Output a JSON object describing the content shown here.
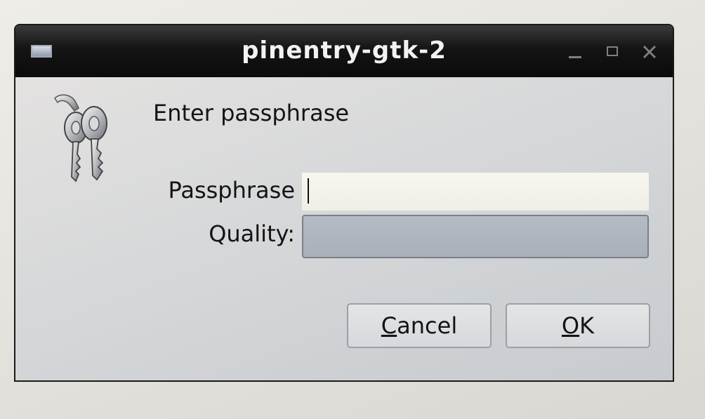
{
  "window": {
    "title": "pinentry-gtk-2"
  },
  "dialog": {
    "prompt": "Enter passphrase",
    "passphrase_label": "Passphrase",
    "passphrase_value": "",
    "quality_label": "Quality:",
    "quality_level": 0
  },
  "buttons": {
    "cancel_mnemonic": "C",
    "cancel_rest": "ancel",
    "ok_mnemonic": "O",
    "ok_rest": "K"
  },
  "icons": {
    "window_menu": "window-menu-icon",
    "keys": "keys-icon",
    "minimize": "minimize-icon",
    "maximize": "maximize-icon",
    "close": "close-icon"
  },
  "colors": {
    "titlebar": "#0b0b0b",
    "title_text": "#f2f2f2",
    "input_background": "#f3f2ea",
    "quality_bar": "#aeb5bf"
  }
}
